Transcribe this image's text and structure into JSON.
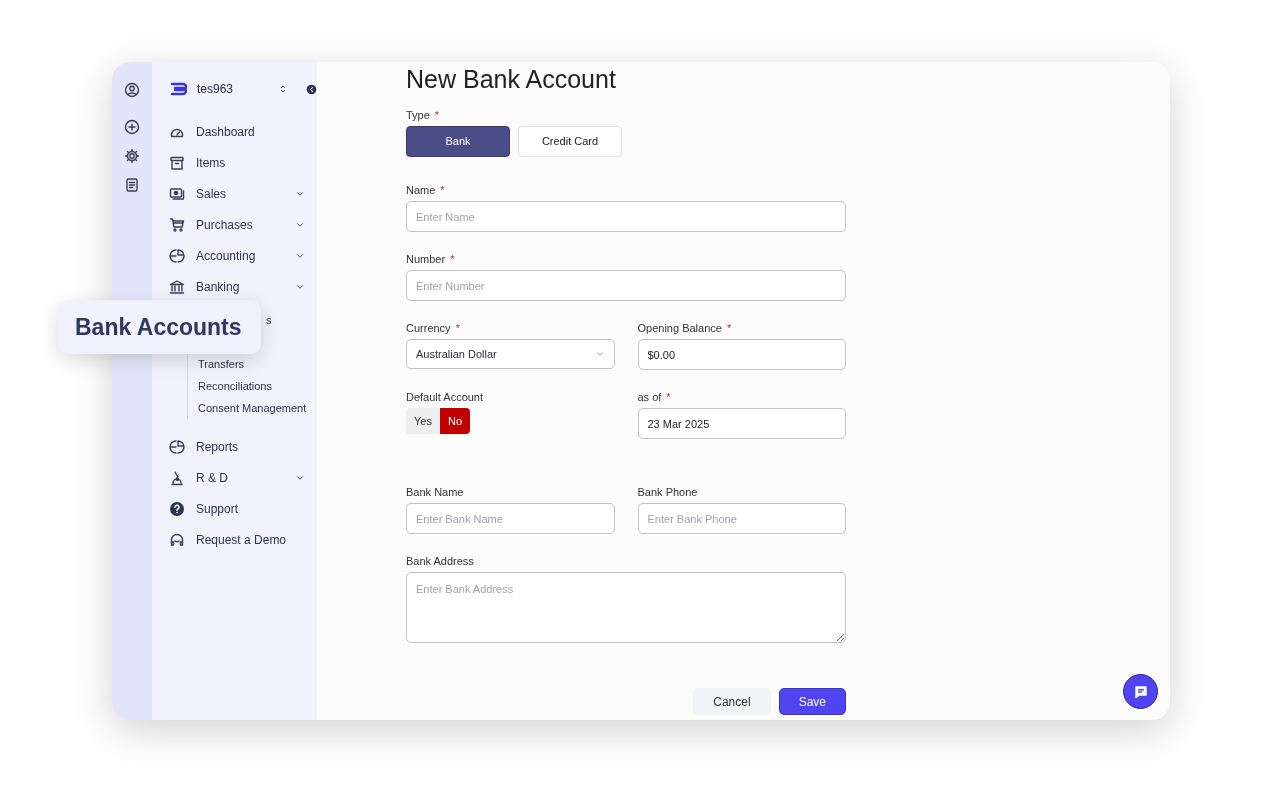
{
  "sidebar": {
    "org": "tes963",
    "items": [
      {
        "label": "Dashboard",
        "expandable": false
      },
      {
        "label": "Items",
        "expandable": false
      },
      {
        "label": "Sales",
        "expandable": true
      },
      {
        "label": "Purchases",
        "expandable": true
      },
      {
        "label": "Accounting",
        "expandable": true
      },
      {
        "label": "Banking",
        "expandable": true,
        "children": [
          {
            "label": "s"
          },
          {
            "label": "Transfers"
          },
          {
            "label": "Reconciliations"
          },
          {
            "label": "Consent Management"
          }
        ]
      },
      {
        "label": "Reports",
        "expandable": false
      },
      {
        "label": "R & D",
        "expandable": true
      },
      {
        "label": "Support",
        "expandable": false
      },
      {
        "label": "Request a Demo",
        "expandable": false
      }
    ]
  },
  "callout": {
    "text": "Bank Accounts"
  },
  "form": {
    "title": "New Bank Account",
    "type": {
      "label": "Type",
      "mark": "*",
      "options": [
        {
          "label": "Bank",
          "selected": true
        },
        {
          "label": "Credit Card",
          "selected": false
        }
      ]
    },
    "rows": [
      [
        {
          "kind": "text",
          "label": "Name",
          "mark": "*",
          "placeholder": "Enter Name"
        }
      ],
      [
        {
          "kind": "text",
          "label": "Number",
          "mark": "*",
          "placeholder": "Enter Number"
        }
      ],
      [
        {
          "kind": "select",
          "label": "Currency",
          "mark": "*",
          "value": "Australian Dollar"
        },
        {
          "kind": "text",
          "label": "Opening Balance",
          "mark": "*",
          "value": "$0.00"
        }
      ],
      [
        {
          "kind": "toggle",
          "label": "Default Account",
          "options": [
            {
              "label": "Yes",
              "selected": false
            },
            {
              "label": "No",
              "selected": true
            }
          ]
        },
        {
          "kind": "text",
          "label": "as of",
          "mark": "*",
          "value": "23 Mar 2025"
        }
      ],
      [
        {
          "kind": "text",
          "label": "Bank Name",
          "placeholder": "Enter Bank Name"
        },
        {
          "kind": "text",
          "label": "Bank Phone",
          "placeholder": "Enter Bank Phone"
        }
      ],
      [
        {
          "kind": "textarea",
          "label": "Bank Address",
          "placeholder": "Enter Bank Address"
        }
      ]
    ],
    "buttons": [
      {
        "label": "Cancel",
        "kind": "secondary"
      },
      {
        "label": "Save",
        "kind": "primary"
      }
    ]
  }
}
